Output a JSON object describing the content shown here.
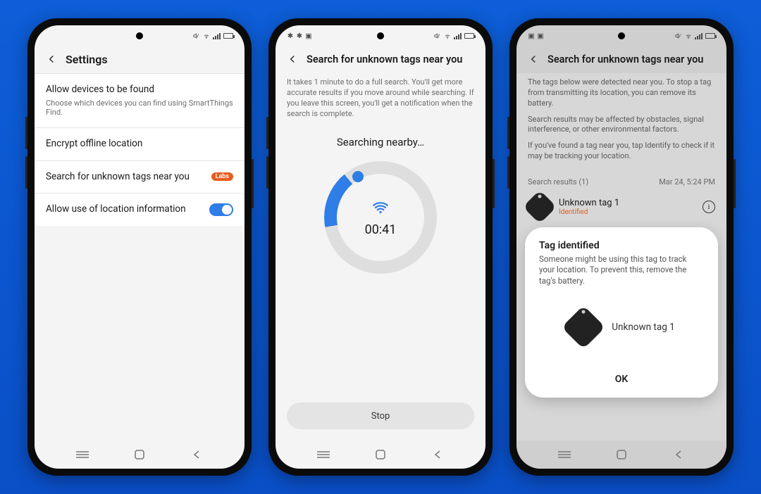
{
  "phone1": {
    "title": "Settings",
    "rows": {
      "allow_found": {
        "title": "Allow devices to be found",
        "sub": "Choose which devices you can find using SmartThings Find."
      },
      "encrypt": {
        "title": "Encrypt offline location"
      },
      "search_tags": {
        "title": "Search for unknown tags near you",
        "badge": "Labs"
      },
      "allow_location": {
        "title": "Allow use of location information"
      }
    }
  },
  "phone2": {
    "title": "Search for unknown tags near you",
    "desc": "It takes 1 minute to do a full search. You'll get more accurate results if you move around while searching. If you leave this screen, you'll get a notification when the search is complete.",
    "searching_label": "Searching nearby…",
    "timer": "00:41",
    "stop": "Stop"
  },
  "phone3": {
    "title": "Search for unknown tags near you",
    "desc1": "The tags below were detected near you. To stop a tag from transmitting its location, you can remove its battery.",
    "desc2": "Search results may be affected by obstacles, signal interference, or other environmental factors.",
    "desc3": "If you've found a tag near you, tap Identify to check if it may be tracking your location.",
    "results_label": "Search results (1)",
    "results_time": "Mar 24, 5:24 PM",
    "result": {
      "name": "Unknown tag 1",
      "status": "Identified"
    },
    "dialog": {
      "title": "Tag identified",
      "body": "Someone might be using this tag to track your location. To prevent this, remove the tag's battery.",
      "item_name": "Unknown tag 1",
      "ok": "OK"
    }
  }
}
